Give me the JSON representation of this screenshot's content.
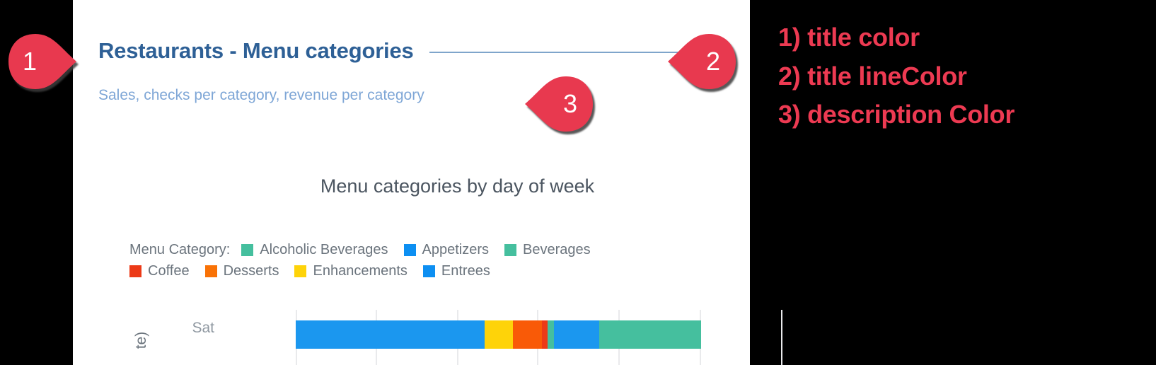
{
  "dashboard": {
    "title": "Restaurants - Menu categories",
    "description": "Sales, checks per category, revenue per category",
    "title_color": "#2e6096",
    "title_line_color": "#7fa5cb",
    "description_color": "#7ea6d6"
  },
  "chart_data": {
    "type": "bar",
    "orientation": "horizontal",
    "stacked": true,
    "title": "Menu categories by day of week",
    "legend_caption": "Menu Category:",
    "legend_position": "top",
    "xlabel": "",
    "ylabel": "te)",
    "categories": [
      "Sat"
    ],
    "grid": true,
    "series": [
      {
        "name": "Entrees",
        "color": "#1b97ef",
        "values": [
          46.5
        ]
      },
      {
        "name": "Enhancements",
        "color": "#fed309",
        "values": [
          7.0
        ]
      },
      {
        "name": "Desserts",
        "color": "#f95a07",
        "values": [
          7.2
        ]
      },
      {
        "name": "Coffee",
        "color": "#ec3a17",
        "values": [
          1.4
        ]
      },
      {
        "name": "Beverages",
        "color": "#45bf9e",
        "values": [
          1.5
        ]
      },
      {
        "name": "Appetizers",
        "color": "#1b97ef",
        "values": [
          11.2
        ]
      },
      {
        "name": "Alcoholic Beverages",
        "color": "#45bf9e",
        "values": [
          25.2
        ]
      }
    ],
    "legend_rows": [
      [
        {
          "label": "Alcoholic Beverages",
          "color": "#45bf9e"
        },
        {
          "label": "Appetizers",
          "color": "#0d8ff2"
        },
        {
          "label": "Beverages",
          "color": "#45bf9e"
        }
      ],
      [
        {
          "label": "Coffee",
          "color": "#ec3a17"
        },
        {
          "label": "Desserts",
          "color": "#f97206"
        },
        {
          "label": "Enhancements",
          "color": "#fed309"
        },
        {
          "label": "Entrees",
          "color": "#0d8ff2"
        }
      ]
    ]
  },
  "annotations": {
    "marker_color": "#e8394f",
    "markers": [
      {
        "id": "1",
        "label": "1"
      },
      {
        "id": "2",
        "label": "2"
      },
      {
        "id": "3",
        "label": "3"
      }
    ],
    "notes": [
      "1) title color",
      "2) title lineColor",
      "3) description Color"
    ]
  }
}
